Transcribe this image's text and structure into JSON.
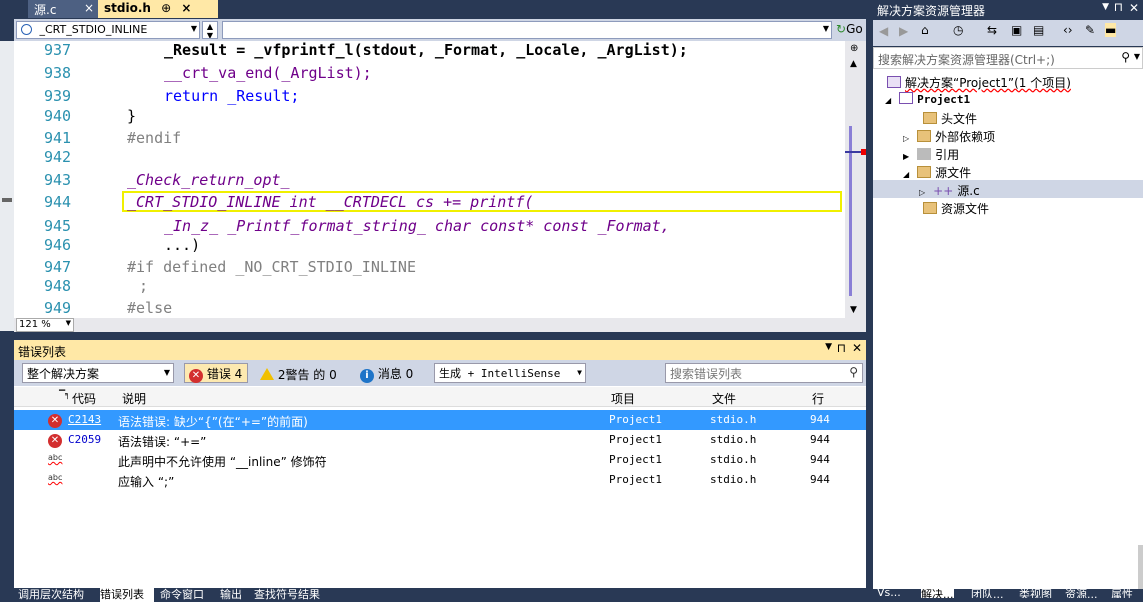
{
  "tabs": [
    {
      "label": "源.c",
      "close": "×"
    },
    {
      "label": "stdio.h",
      "close": "×",
      "pin": "⊕"
    }
  ],
  "nav": {
    "scope": "_CRT_STDIO_INLINE",
    "member": "",
    "go": "Go"
  },
  "code_lines": [
    {
      "num": "937",
      "text": "_Result = _vfprintf_l(stdout, _Format, _Locale, _ArgList);"
    },
    {
      "num": "938",
      "text": "__crt_va_end(_ArgList);"
    },
    {
      "num": "939",
      "text": "return _Result;"
    },
    {
      "num": "940",
      "text": "}"
    },
    {
      "num": "941",
      "text": "#endif"
    },
    {
      "num": "942",
      "text": ""
    },
    {
      "num": "943",
      "text": "_Check_return_opt_"
    },
    {
      "num": "944",
      "text": "_CRT_STDIO_INLINE int __CRTDECL cs += printf("
    },
    {
      "num": "945",
      "text": "_In_z_ _Printf_format_string_ char const* const _Format,"
    },
    {
      "num": "946",
      "text": "...)"
    },
    {
      "num": "947",
      "text": "#if defined _NO_CRT_STDIO_INLINE"
    },
    {
      "num": "948",
      "text": ";"
    },
    {
      "num": "949",
      "text": "#else"
    }
  ],
  "zoom": "121 %",
  "errors": {
    "title": "错误列表",
    "scope": "整个解决方案",
    "errors_btn": "错误 4",
    "warnings_btn": "2警告 的 0",
    "messages_btn": "消息 0",
    "build": "生成 + IntelliSense",
    "search_placeholder": "搜索错误列表",
    "cols": {
      "code": "代码",
      "desc": "说明",
      "project": "项目",
      "file": "文件",
      "line": "行"
    },
    "rows": [
      {
        "code": "C2143",
        "desc": "语法错误: 缺少“{”(在“+=”的前面)",
        "project": "Project1",
        "file": "stdio.h",
        "line": "944"
      },
      {
        "code": "C2059",
        "desc": "语法错误: “+=”",
        "project": "Project1",
        "file": "stdio.h",
        "line": "944"
      },
      {
        "code": "",
        "desc": "此声明中不允许使用 “__inline” 修饰符",
        "project": "Project1",
        "file": "stdio.h",
        "line": "944"
      },
      {
        "code": "",
        "desc": "应输入 “;”",
        "project": "Project1",
        "file": "stdio.h",
        "line": "944"
      }
    ],
    "abc": "abc"
  },
  "bottom_tabs": [
    "调用层次结构",
    "错误列表",
    "命令窗口",
    "输出",
    "查找符号结果"
  ],
  "solution": {
    "title": "解决方案资源管理器",
    "search_placeholder": "搜索解决方案资源管理器(Ctrl+;)",
    "items": [
      {
        "label": "解决方案“Project1”(1 个项目)"
      },
      {
        "label": "Project1"
      },
      {
        "label": "头文件"
      },
      {
        "label": "外部依赖项"
      },
      {
        "label": "引用"
      },
      {
        "label": "源文件"
      },
      {
        "label": "源.c"
      },
      {
        "label": "资源文件"
      }
    ],
    "bottom_tabs": [
      "Vs...",
      "解决...",
      "团队...",
      "类视图",
      "资源...",
      "属性"
    ]
  }
}
